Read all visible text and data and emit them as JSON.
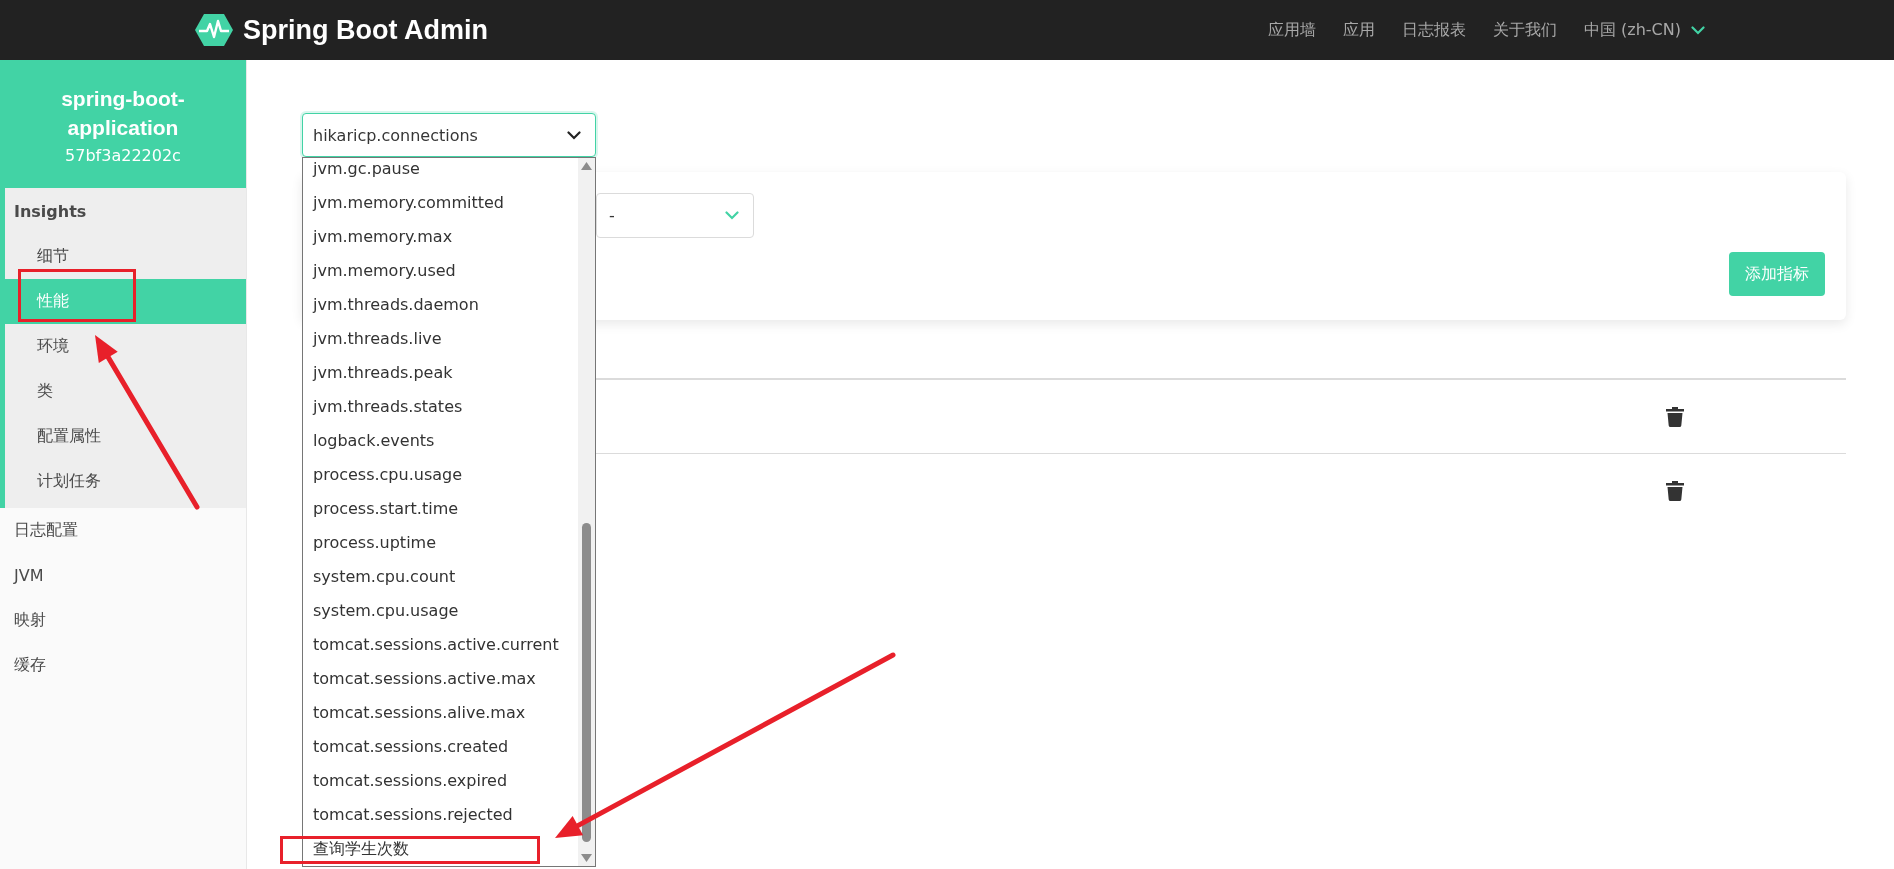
{
  "app": {
    "title": "Spring Boot Admin"
  },
  "nav": [
    {
      "label": "应用墙",
      "kind": "link"
    },
    {
      "label": "应用",
      "kind": "link"
    },
    {
      "label": "日志报表",
      "kind": "link"
    },
    {
      "label": "关于我们",
      "kind": "link"
    },
    {
      "label": "中国 (zh-CN)",
      "kind": "dropdown"
    }
  ],
  "instance": {
    "name": "spring-boot-application",
    "id": "57bf3a22202c"
  },
  "sidebar": {
    "items": [
      {
        "label": "Insights",
        "selected": false,
        "children": [
          {
            "label": "细节",
            "selected": false
          },
          {
            "label": "性能",
            "selected": true
          },
          {
            "label": "环境",
            "selected": false
          },
          {
            "label": "类",
            "selected": false
          },
          {
            "label": "配置属性",
            "selected": false
          },
          {
            "label": "计划任务",
            "selected": false
          }
        ]
      },
      {
        "label": "日志配置",
        "selected": false
      },
      {
        "label": "JVM",
        "selected": false
      },
      {
        "label": "映射",
        "selected": false
      },
      {
        "label": "缓存",
        "selected": false
      }
    ]
  },
  "metric_select": {
    "value": "hikaricp.connections",
    "expanded": true,
    "options": [
      "jvm.gc.pause",
      "jvm.memory.committed",
      "jvm.memory.max",
      "jvm.memory.used",
      "jvm.threads.daemon",
      "jvm.threads.live",
      "jvm.threads.peak",
      "jvm.threads.states",
      "logback.events",
      "process.cpu.usage",
      "process.start.time",
      "process.uptime",
      "system.cpu.count",
      "system.cpu.usage",
      "tomcat.sessions.active.current",
      "tomcat.sessions.active.max",
      "tomcat.sessions.alive.max",
      "tomcat.sessions.created",
      "tomcat.sessions.expired",
      "tomcat.sessions.rejected",
      "查询学生次数"
    ]
  },
  "tag_select": {
    "value": "-"
  },
  "add_button": {
    "label": "添加指标"
  },
  "metric_rows": [
    {
      "deletable": true
    },
    {
      "deletable": true
    }
  ],
  "annotations": [
    {
      "kind": "box"
    },
    {
      "kind": "arrow"
    },
    {
      "kind": "box"
    },
    {
      "kind": "arrow"
    }
  ]
}
